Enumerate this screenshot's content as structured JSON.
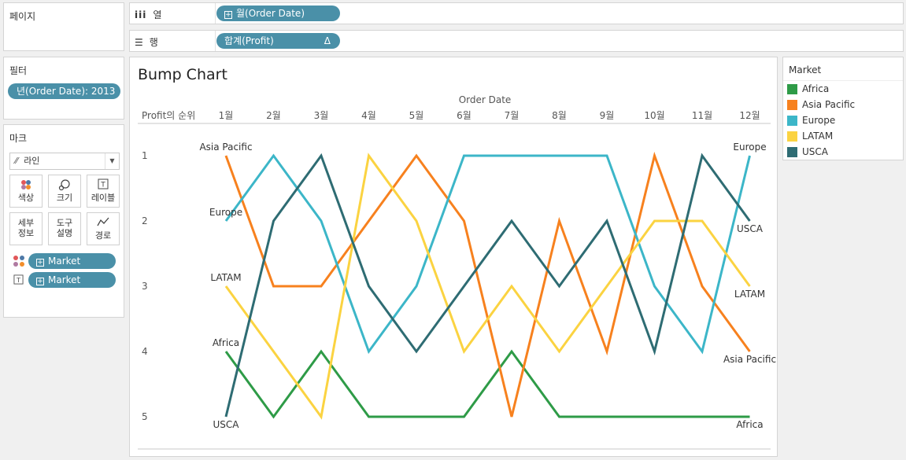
{
  "pages_card": {
    "title": "페이지"
  },
  "shelves": {
    "columns": {
      "label": "열",
      "pill": "월(Order Date)"
    },
    "rows": {
      "label": "행",
      "pill": "합계(Profit)",
      "pill_suffix": "Δ"
    }
  },
  "filters_card": {
    "title": "필터",
    "pill": "년(Order Date): 2013"
  },
  "marks_card": {
    "title": "마크",
    "mark_type": "라인",
    "buttons": [
      {
        "label": "색상",
        "icon": "color-icon"
      },
      {
        "label": "크기",
        "icon": "size-icon"
      },
      {
        "label": "레이블",
        "icon": "label-icon"
      },
      {
        "label": "세부\n정보",
        "icon": "detail-icon"
      },
      {
        "label": "도구\n설명",
        "icon": "tooltip-icon"
      },
      {
        "label": "경로",
        "icon": "path-icon"
      }
    ],
    "fields": [
      {
        "type": "color",
        "pill": "Market"
      },
      {
        "type": "label",
        "pill": "Market"
      }
    ]
  },
  "legend": {
    "title": "Market",
    "items": [
      {
        "name": "Africa",
        "color": "#2e9b47"
      },
      {
        "name": "Asia Pacific",
        "color": "#f7811e"
      },
      {
        "name": "Europe",
        "color": "#3cb6c8"
      },
      {
        "name": "LATAM",
        "color": "#fbd341"
      },
      {
        "name": "USCA",
        "color": "#2e6c73"
      }
    ]
  },
  "chart_data": {
    "type": "line",
    "title": "Bump Chart",
    "x_title": "Order Date",
    "row_header": "Profit의 순위",
    "categories": [
      "1월",
      "2월",
      "3월",
      "4월",
      "5월",
      "6월",
      "7월",
      "8월",
      "9월",
      "10월",
      "11월",
      "12월"
    ],
    "y_ticks": [
      1,
      2,
      3,
      4,
      5
    ],
    "ylim": [
      1,
      5
    ],
    "y_inverted": true,
    "grid": false,
    "series": [
      {
        "name": "Africa",
        "color": "#2e9b47",
        "values": [
          4,
          5,
          4,
          5,
          5,
          5,
          4,
          5,
          5,
          5,
          5,
          5
        ]
      },
      {
        "name": "Asia Pacific",
        "color": "#f7811e",
        "values": [
          1,
          3,
          3,
          2,
          1,
          2,
          5,
          2,
          4,
          1,
          3,
          4
        ]
      },
      {
        "name": "Europe",
        "color": "#3cb6c8",
        "values": [
          2,
          1,
          2,
          4,
          3,
          1,
          1,
          1,
          1,
          3,
          4,
          1
        ]
      },
      {
        "name": "LATAM",
        "color": "#fbd341",
        "values": [
          3,
          4,
          5,
          1,
          2,
          4,
          3,
          4,
          3,
          2,
          2,
          3
        ]
      },
      {
        "name": "USCA",
        "color": "#2e6c73",
        "values": [
          5,
          2,
          1,
          3,
          4,
          3,
          2,
          3,
          2,
          4,
          1,
          2
        ]
      }
    ]
  }
}
